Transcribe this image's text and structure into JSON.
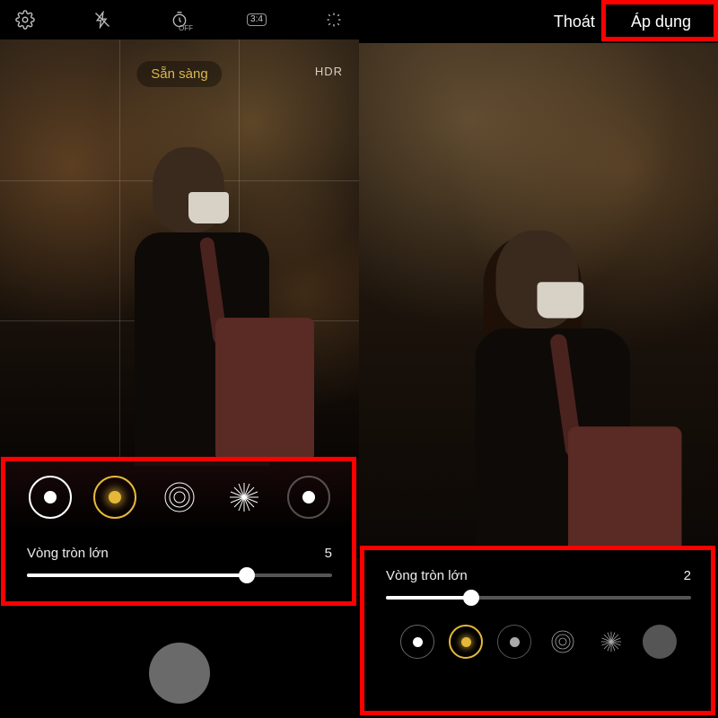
{
  "left": {
    "toolbar": {
      "timer_off": "OFF",
      "ratio": "3:4"
    },
    "ready_label": "Sẵn sàng",
    "hdr_label": "HDR",
    "slider": {
      "label": "Vòng tròn lớn",
      "value": "5",
      "percent": 72
    },
    "bokeh_options": [
      "solid-dot",
      "glow-dot",
      "concentric-rings",
      "starburst",
      "soft-dot"
    ],
    "bokeh_selected_index": 1
  },
  "right": {
    "exit_label": "Thoát",
    "apply_label": "Áp dụng",
    "slider": {
      "label": "Vòng tròn lớn",
      "value": "2",
      "percent": 28
    },
    "bokeh_options": [
      "solid-dot",
      "glow-dot",
      "soft-dot",
      "concentric-rings",
      "starburst",
      "half-moon"
    ],
    "bokeh_selected_index": 1
  },
  "highlights": {
    "apply_button": true,
    "left_bokeh_panel": true,
    "right_controls_panel": true
  }
}
